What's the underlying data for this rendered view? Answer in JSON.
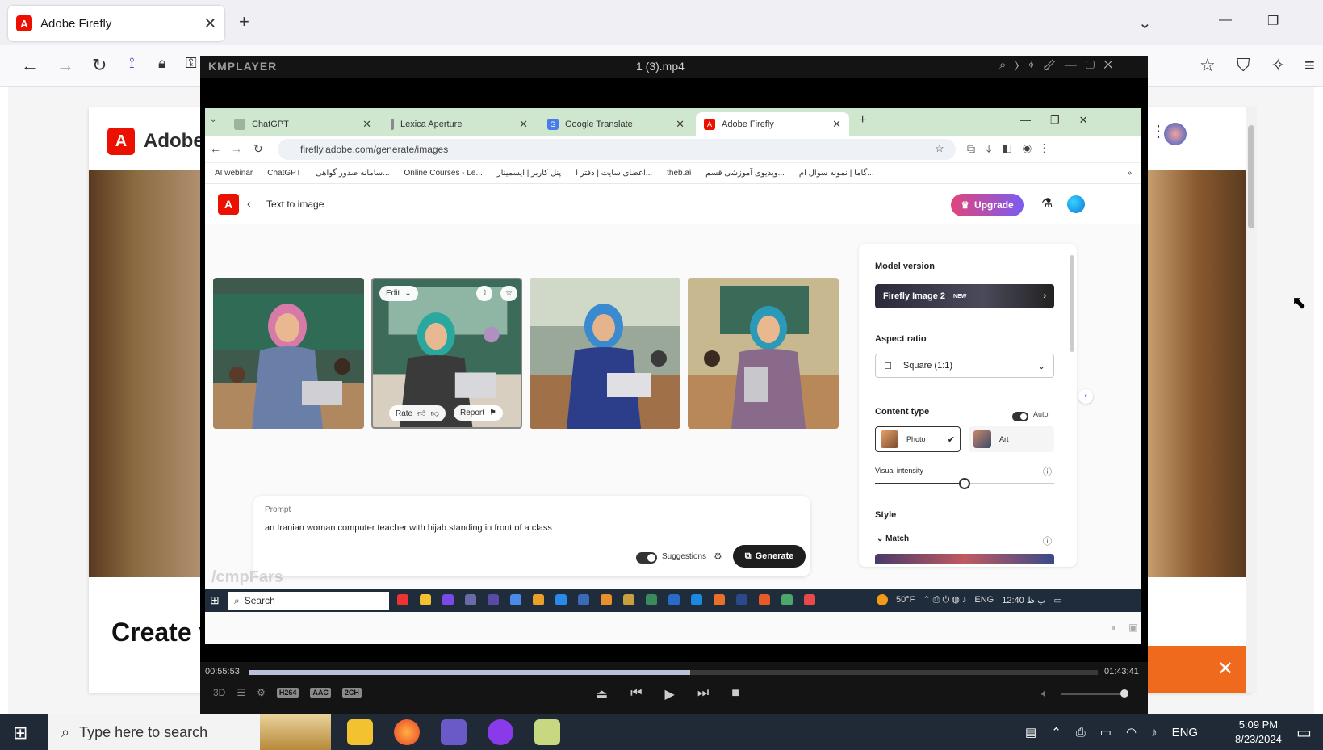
{
  "outer_browser": {
    "tab_title": "Adobe Firefly",
    "tab_close": "✕",
    "new_tab": "+",
    "window_controls": {
      "list": "⌄",
      "minimize": "—",
      "restore": "❐"
    },
    "toolbar_icons": [
      "back-arrow-icon",
      "forward-arrow-icon",
      "reload-icon",
      "extensions-icon",
      "lock-icon",
      "key-icon"
    ],
    "right_toolbar_icons": [
      "star-icon",
      "shield-icon",
      "sparkle-icon",
      "menu-icon"
    ]
  },
  "site": {
    "brand": "Adobe",
    "hero_text": "Create v",
    "banner_close": "✕"
  },
  "kmplayer": {
    "logo": "KMPLAYER",
    "file_name": "1 (3).mp4",
    "elapsed": "00:55:53",
    "total": "01:43:41",
    "progress_fraction": 0.52,
    "codecs": [
      "H264",
      "AAC",
      "2CH"
    ],
    "left_labels": [
      "3D"
    ]
  },
  "inner_browser": {
    "tabs": [
      {
        "label": "ChatGPT",
        "active": false
      },
      {
        "label": "Lexica Aperture",
        "active": false
      },
      {
        "label": "Google Translate",
        "active": false
      },
      {
        "label": "Adobe Firefly",
        "active": true
      }
    ],
    "new_tab": "+",
    "url": "firefly.adobe.com/generate/images",
    "bookmarks": [
      "AI webinar",
      "ChatGPT",
      "سامانه صدور گواهی...",
      "Online Courses - Le...",
      "پنل کاربر | ایسمینار",
      "اعضای سایت | دفتر ا...",
      "theb.ai",
      "ویدیوی آموزشی قسم...",
      "گاما | نمونه سوال ام..."
    ],
    "bookmarks_more": "»"
  },
  "firefly": {
    "page_title": "Text to image",
    "upgrade_label": "Upgrade",
    "image_overlay": {
      "edit_label": "Edit",
      "rate_label": "Rate",
      "report_label": "Report"
    },
    "prompt_label": "Prompt",
    "prompt_text": "an Iranian woman computer teacher with hijab standing in front of a class",
    "suggestions_label": "Suggestions",
    "generate_label": "Generate",
    "watermark": "/cmpFars",
    "panel": {
      "model_version_label": "Model version",
      "model_name": "Firefly Image 2",
      "model_badge": "NEW",
      "aspect_ratio_label": "Aspect ratio",
      "aspect_ratio_value": "Square (1:1)",
      "content_type_label": "Content type",
      "auto_label": "Auto",
      "photo_label": "Photo",
      "art_label": "Art",
      "visual_intensity_label": "Visual intensity",
      "visual_intensity_fraction": 0.5,
      "style_label": "Style",
      "match_label": "Match"
    }
  },
  "inner_taskbar": {
    "search_label": "Search",
    "weather": "50°F",
    "language": "ENG",
    "time": "12:40 ب.ظ"
  },
  "taskbar": {
    "search_placeholder": "Type here to search",
    "language": "ENG",
    "time": "5:09 PM",
    "date": "8/23/2024"
  },
  "colors": {
    "adobe_red": "#eb1000",
    "upgrade_start": "#e0457b",
    "upgrade_end": "#7b5cf0",
    "taskbar": "#1f2a36",
    "kmplayer_bg": "#000000"
  }
}
